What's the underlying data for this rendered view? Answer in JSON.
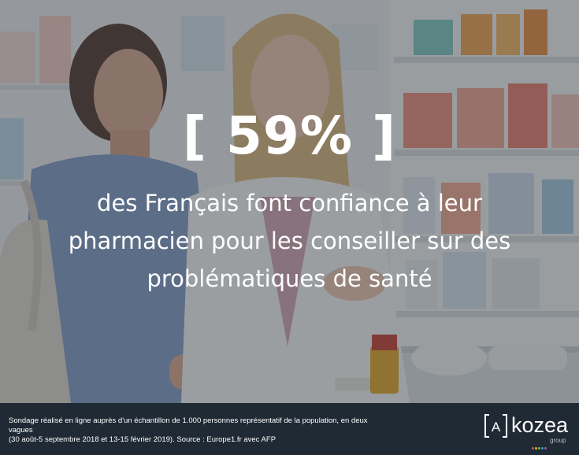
{
  "stat": {
    "value": "[ 59% ]"
  },
  "headline": {
    "lines": [
      "des Français font confiance à leur",
      "pharmacien pour les conseiller sur des",
      "problématiques de santé"
    ]
  },
  "footer": {
    "source_lines": [
      "Sondage réalisé en ligne auprès d'un échantillon de 1.000 personnes représentatif de la population, en deux vagues",
      "(30 août-5 septembre 2018 et 13-15 février 2019). Source : Europe1.fr avec AFP"
    ]
  },
  "logo": {
    "letter": "A",
    "name": "kozea",
    "subtitle": "group",
    "dot_colors": [
      "#e8543a",
      "#f2b51c",
      "#5cb85c",
      "#3a8fd8",
      "#9b59b6"
    ]
  },
  "colors": {
    "footer_bg": "#1f2a34",
    "text": "#ffffff"
  }
}
